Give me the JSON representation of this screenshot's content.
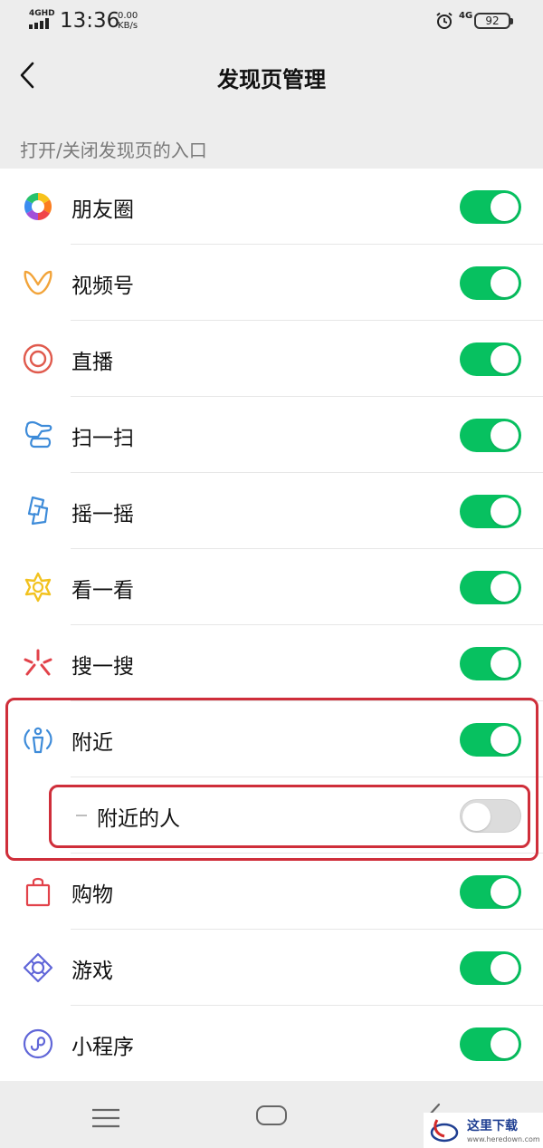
{
  "status_bar": {
    "network": "4GHD",
    "time": "13:36",
    "speed_value": "0.00",
    "speed_unit": "KB/s",
    "network_right": "4G",
    "battery": "92",
    "icons": [
      "signal-icon",
      "alarm-icon",
      "battery-icon"
    ]
  },
  "nav": {
    "title": "发现页管理",
    "back_icon": "back-arrow-icon"
  },
  "section_header": "打开/关闭发现页的入口",
  "items": [
    {
      "label": "朋友圈",
      "icon": "moments-icon",
      "enabled": true
    },
    {
      "label": "视频号",
      "icon": "channels-icon",
      "enabled": true
    },
    {
      "label": "直播",
      "icon": "live-icon",
      "enabled": true
    },
    {
      "label": "扫一扫",
      "icon": "scan-icon",
      "enabled": true
    },
    {
      "label": "摇一摇",
      "icon": "shake-icon",
      "enabled": true
    },
    {
      "label": "看一看",
      "icon": "top-stories-icon",
      "enabled": true
    },
    {
      "label": "搜一搜",
      "icon": "search-icon",
      "enabled": true
    },
    {
      "label": "附近",
      "icon": "nearby-icon",
      "enabled": true
    },
    {
      "label": "附近的人",
      "icon": "",
      "enabled": false,
      "sub": true
    },
    {
      "label": "购物",
      "icon": "shopping-icon",
      "enabled": true
    },
    {
      "label": "游戏",
      "icon": "games-icon",
      "enabled": true
    },
    {
      "label": "小程序",
      "icon": "mini-programs-icon",
      "enabled": true
    }
  ],
  "colors": {
    "toggle_on": "#07c160",
    "toggle_off": "#dcdcdc",
    "highlight": "#cf2e3a",
    "background": "#ededed"
  },
  "bottom_nav": {
    "icons": [
      "menu-icon",
      "home-icon",
      "back-icon"
    ]
  },
  "watermark": {
    "text": "这里下载",
    "url": "www.heredown.com"
  }
}
